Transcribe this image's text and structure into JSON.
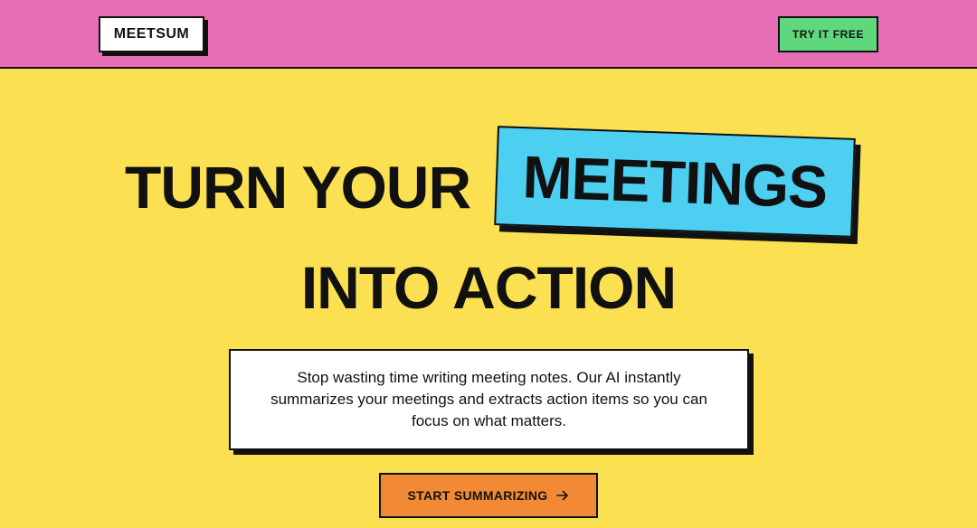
{
  "header": {
    "logo_text": "MEETSUM",
    "cta_label": "TRY IT FREE",
    "background_color": "#e86db7",
    "cta_color": "#5fd87d"
  },
  "hero": {
    "headline_part1": "TURN YOUR",
    "headline_highlight": "MEETINGS",
    "headline_line2": "INTO ACTION",
    "highlight_color": "#4dcff2",
    "description": "Stop wasting time writing meeting notes. Our AI instantly summarizes your meetings and extracts action items so you can focus on what matters.",
    "cta_label": "START SUMMARIZING",
    "cta_icon": "arrow-right-icon",
    "cta_color": "#f28a35",
    "background_color": "#fbe052"
  }
}
